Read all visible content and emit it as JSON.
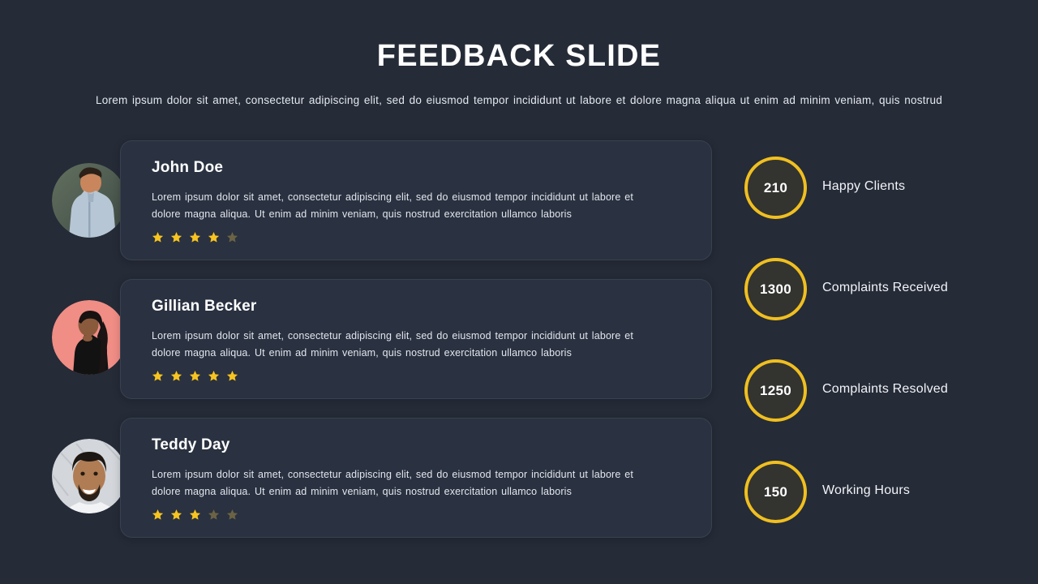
{
  "header": {
    "title": "FEEDBACK SLIDE",
    "subtitle": "Lorem ipsum dolor sit amet, consectetur adipiscing elit, sed do eiusmod tempor incididunt ut labore et dolore magna aliqua ut enim ad minim veniam, quis nostrud"
  },
  "colors": {
    "page_background": "#252b37",
    "card_background": "#2a3140",
    "card_border": "#39414f",
    "accent_gold": "#f0bf20",
    "star_full": "#f7c420",
    "star_empty": "#6b6344",
    "circle_fill": "#333330",
    "text_primary": "#ffffff",
    "text_secondary": "#e2e6ee"
  },
  "testimonials": [
    {
      "name": "John Doe",
      "text": "Lorem ipsum dolor sit amet, consectetur adipiscing elit, sed do eiusmod tempor incididunt ut labore et dolore magna aliqua. Ut enim ad minim veniam, quis nostrud exercitation ullamco laboris",
      "rating": 4,
      "max_rating": 5,
      "avatar": {
        "name": "avatar-john-doe",
        "description": "Smiling man in light blue button-up shirt",
        "bg": "#5d6d62",
        "bg2": "#47534b",
        "skin": "#c98f66",
        "hair": "#2b2118",
        "clothing": "#b7c6d4"
      }
    },
    {
      "name": "Gillian Becker",
      "text": "Lorem ipsum dolor sit amet, consectetur adipiscing elit, sed do eiusmod tempor incididunt ut labore et dolore magna aliqua. Ut enim ad minim veniam, quis nostrud exercitation ullamco laboris",
      "rating": 5,
      "max_rating": 5,
      "avatar": {
        "name": "avatar-gillian-becker",
        "description": "Woman with long dark hair in black top on salmon pink background",
        "bg": "#f08d85",
        "bg2": "#e8847c",
        "skin": "#8a5a3c",
        "hair": "#181212",
        "clothing": "#121212"
      }
    },
    {
      "name": "Teddy Day",
      "text": "Lorem ipsum dolor sit amet, consectetur adipiscing elit, sed do eiusmod tempor incididunt ut labore et dolore magna aliqua. Ut enim ad minim veniam, quis nostrud exercitation ullamco laboris",
      "rating": 3,
      "max_rating": 5,
      "avatar": {
        "name": "avatar-teddy-day",
        "description": "Smiling man with dark hair and beard in white shirt on light gray background",
        "bg": "#d3d6da",
        "bg2": "#c3c7cc",
        "skin": "#b07c53",
        "hair": "#1d1713",
        "clothing": "#f2f3f5"
      }
    }
  ],
  "stats": [
    {
      "value": "210",
      "label": "Happy Clients"
    },
    {
      "value": "1300",
      "label": "Complaints Received"
    },
    {
      "value": "1250",
      "label": "Complaints Resolved"
    },
    {
      "value": "150",
      "label": "Working Hours"
    }
  ]
}
